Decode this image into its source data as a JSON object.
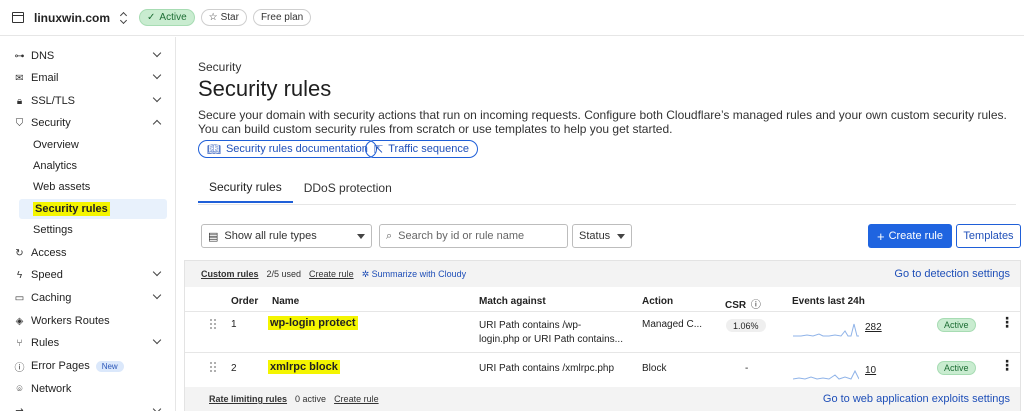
{
  "topbar": {
    "domain": "linuxwin.com",
    "status": "Active",
    "star_label": "Star",
    "plan": "Free plan"
  },
  "sidebar": {
    "items": [
      {
        "label": "DNS",
        "icon": "dns-icon",
        "expandable": true
      },
      {
        "label": "Email",
        "icon": "email-icon",
        "expandable": true
      },
      {
        "label": "SSL/TLS",
        "icon": "lock-icon",
        "expandable": true
      },
      {
        "label": "Security",
        "icon": "shield-icon",
        "expandable": true,
        "expanded": true
      },
      {
        "label": "Access",
        "icon": "access-icon",
        "expandable": false
      },
      {
        "label": "Speed",
        "icon": "lightning-icon",
        "expandable": true
      },
      {
        "label": "Caching",
        "icon": "caching-icon",
        "expandable": true
      },
      {
        "label": "Workers Routes",
        "icon": "workers-icon",
        "expandable": false
      },
      {
        "label": "Rules",
        "icon": "rules-icon",
        "expandable": true
      },
      {
        "label": "Error Pages",
        "icon": "error-pages-icon",
        "expandable": false,
        "badge": "New"
      },
      {
        "label": "Network",
        "icon": "network-icon",
        "expandable": false
      }
    ],
    "security_sub": [
      "Overview",
      "Analytics",
      "Web assets",
      "Security rules",
      "Settings"
    ]
  },
  "main": {
    "eyebrow": "Security",
    "title": "Security rules",
    "description": "Secure your domain with security actions that run on incoming requests. Configure both Cloudflare’s managed rules and your own custom security rules. You can build custom security rules from scratch or use templates to help you get started.",
    "links": [
      "Security rules documentation",
      "Traffic sequence"
    ],
    "tabs": [
      "Security rules",
      "DDoS protection"
    ],
    "filter_rule_types": "Show all rule types",
    "search_placeholder": "Search by id or rule name",
    "status_label": "Status",
    "create_rule": "Create rule",
    "templates": "Templates"
  },
  "panel": {
    "custom_rules_label": "Custom rules",
    "custom_rules_used": "2/5 used",
    "create_rule_link": "Create rule",
    "summarize": "Summarize with Cloudy",
    "detection_link": "Go to detection settings",
    "columns": [
      "Order",
      "Name",
      "Match against",
      "Action",
      "CSR",
      "Events last 24h"
    ],
    "rows": [
      {
        "order": "1",
        "name": "wp-login protect",
        "match_line1": "URI Path contains /wp-",
        "match_line2": "login.php or URI Path contains...",
        "action": "Managed C...",
        "csr": "1.06%",
        "events": "282",
        "status": "Active"
      },
      {
        "order": "2",
        "name": "xmlrpc block",
        "match_line1": "URI Path contains /xmlrpc.php",
        "match_line2": "",
        "action": "Block",
        "csr": "-",
        "events": "10",
        "status": "Active"
      }
    ],
    "rate_limiting_label": "Rate limiting rules",
    "rate_limiting_active": "0 active",
    "rate_create_link": "Create rule",
    "waf_link": "Go to web application exploits settings"
  },
  "colors": {
    "accent": "#1f64e0",
    "active_green_bg": "#c9ecd0",
    "highlight": "#f4f500",
    "sparkline": "#8fb3e8"
  }
}
